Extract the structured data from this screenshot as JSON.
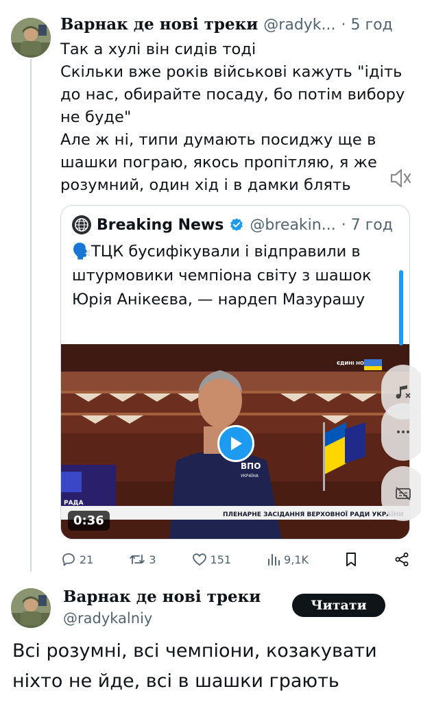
{
  "tweet1": {
    "author_name": "Варнак де нові треки",
    "handle": "@radyk...",
    "time": "· 5 год",
    "text": "Так а хулі він сидів тоді\nСкільки вже років військові кажуть \"ідіть до нас, обирайте посаду, бо потім вибору не буде\"\nАле ж ні, типи думають посиджу ще в шашки пограю, якось пропітляю, я же розумний, один хід і в дамки блять"
  },
  "quote": {
    "author_name": "Breaking News",
    "handle": "@breakin...",
    "time": "· 7 год",
    "text": "🗣️ТЦК бусифікували і відправили в штурмовики чемпіона світу з шашок Юрія Анікеєва, — нардеп Мазурашу",
    "video": {
      "duration": "0:36",
      "channel_badge": "ЄДИНІ НОВИНИ",
      "caption": "ПЛЕНАРНЕ ЗАСІДАННЯ ВЕРХОВНОЇ РАДИ УКРАЇНИ",
      "corner_label": "РАДА",
      "shirt_logo": "ВПО",
      "shirt_sub": "УКРАЇНА"
    }
  },
  "actions": {
    "replies": "21",
    "reposts": "3",
    "likes": "151",
    "views": "9,1K"
  },
  "tweet2": {
    "author_name": "Варнак де нові треки",
    "handle": "@radykalniy",
    "follow_label": "Читати",
    "text": "Всі розумні, всі чемпіони, козакувати ніхто не йде, всі в шашки грають"
  },
  "colors": {
    "accent": "#1d9bf0",
    "text": "#0f1419",
    "secondary": "#536471",
    "border": "#cfd9de"
  }
}
